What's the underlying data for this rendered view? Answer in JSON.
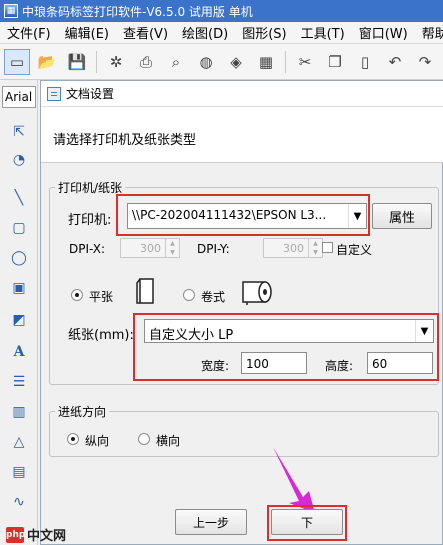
{
  "window": {
    "title": "中琅条码标签打印软件-V6.5.0 试用版 单机"
  },
  "menu": [
    "文件(F)",
    "编辑(E)",
    "查看(V)",
    "绘图(D)",
    "图形(S)",
    "工具(T)",
    "窗口(W)",
    "帮助"
  ],
  "left_panel": {
    "font_name": "Arial"
  },
  "dialog": {
    "title": "文档设置",
    "prompt": "请选择打印机及纸张类型",
    "printer_group": {
      "label": "打印机/纸张",
      "printer_label": "打印机:",
      "printer_value": "\\\\PC-202004111432\\EPSON L3...",
      "properties_button": "属性",
      "dpi_x_label": "DPI-X:",
      "dpi_x_value": "300",
      "dpi_y_label": "DPI-Y:",
      "dpi_y_value": "300",
      "custom_label": "自定义",
      "sheet_label": "平张",
      "roll_label": "卷式",
      "paper_label": "纸张(mm):",
      "paper_value": "自定义大小 LP",
      "width_label": "宽度:",
      "width_value": "100",
      "height_label": "高度:",
      "height_value": "60"
    },
    "feed_group": {
      "label": "进纸方向",
      "portrait_label": "纵向",
      "landscape_label": "横向"
    },
    "buttons": {
      "prev": "上一步",
      "next": "下"
    }
  },
  "watermark": {
    "logo_text": "php",
    "text": "中文网"
  },
  "colors": {
    "highlight": "#d9302c",
    "titlebar": "#3a73c9",
    "annotation_arrow": "#d62ad6"
  }
}
